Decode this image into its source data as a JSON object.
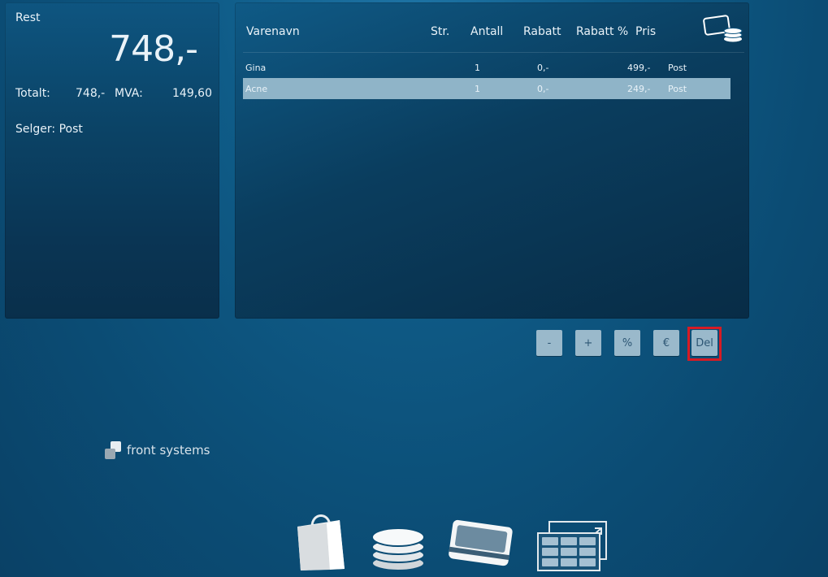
{
  "summary": {
    "rest_label": "Rest",
    "rest_amount": "748,-",
    "totalt_label": "Totalt:",
    "totalt_value": "748,-",
    "mva_label": "MVA:",
    "mva_value": "149,60",
    "seller_label": "Selger:",
    "seller_value": "Post"
  },
  "table": {
    "headers": {
      "name": "Varenavn",
      "size": "Str.",
      "qty": "Antall",
      "discount": "Rabatt",
      "discount_pct": "Rabatt %",
      "price": "Pris"
    },
    "rows": [
      {
        "name": "Gina",
        "qty": "1",
        "discount": "0,-",
        "price": "499,-",
        "seller": "Post",
        "selected": false
      },
      {
        "name": "Acne",
        "qty": "1",
        "discount": "0,-",
        "price": "249,-",
        "seller": "Post",
        "selected": true
      }
    ]
  },
  "actions": {
    "minus": "-",
    "plus": "+",
    "percent": "%",
    "euro": "€",
    "delete": "Del"
  },
  "brand": {
    "name": "front systems"
  },
  "dock": [
    "shopping-bag-icon",
    "coins-icon",
    "card-icon",
    "keypad-icon"
  ],
  "colors": {
    "highlight_row": "#8fb4c8",
    "button_bg": "#9ab9cb",
    "focus_border": "#d61b24"
  }
}
